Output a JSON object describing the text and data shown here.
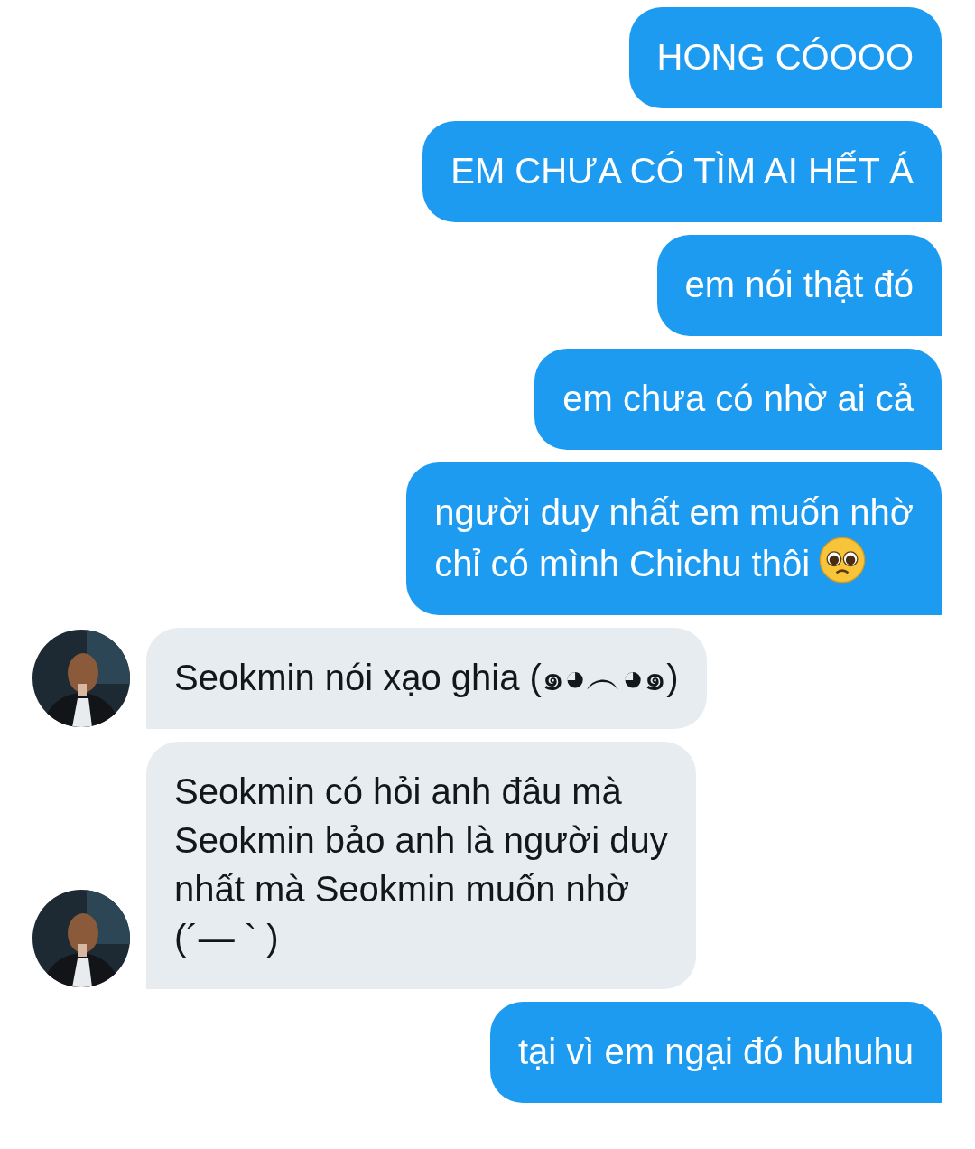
{
  "messages": [
    {
      "kind": "sent",
      "text": "HONG CÓOOO"
    },
    {
      "kind": "sent",
      "text": "EM CHƯA CÓ TÌM AI HẾT Á"
    },
    {
      "kind": "sent",
      "text": "em nói thật đó"
    },
    {
      "kind": "sent",
      "text": "em chưa có nhờ ai cả"
    },
    {
      "kind": "sent",
      "text": "người duy nhất em muốn nhờ\nchỉ có mình Chichu thôi",
      "face_icon": true
    },
    {
      "kind": "received",
      "text": "Seokmin nói xạo ghia (๑◕︵◕๑)"
    },
    {
      "kind": "received",
      "text": "Seokmin có hỏi anh đâu mà\nSeokmin bảo anh là người duy\nnhất mà Seokmin muốn nhờ\n(´— ` )"
    },
    {
      "kind": "sent",
      "text": "tại vì em ngại đó huhuhu"
    }
  ]
}
